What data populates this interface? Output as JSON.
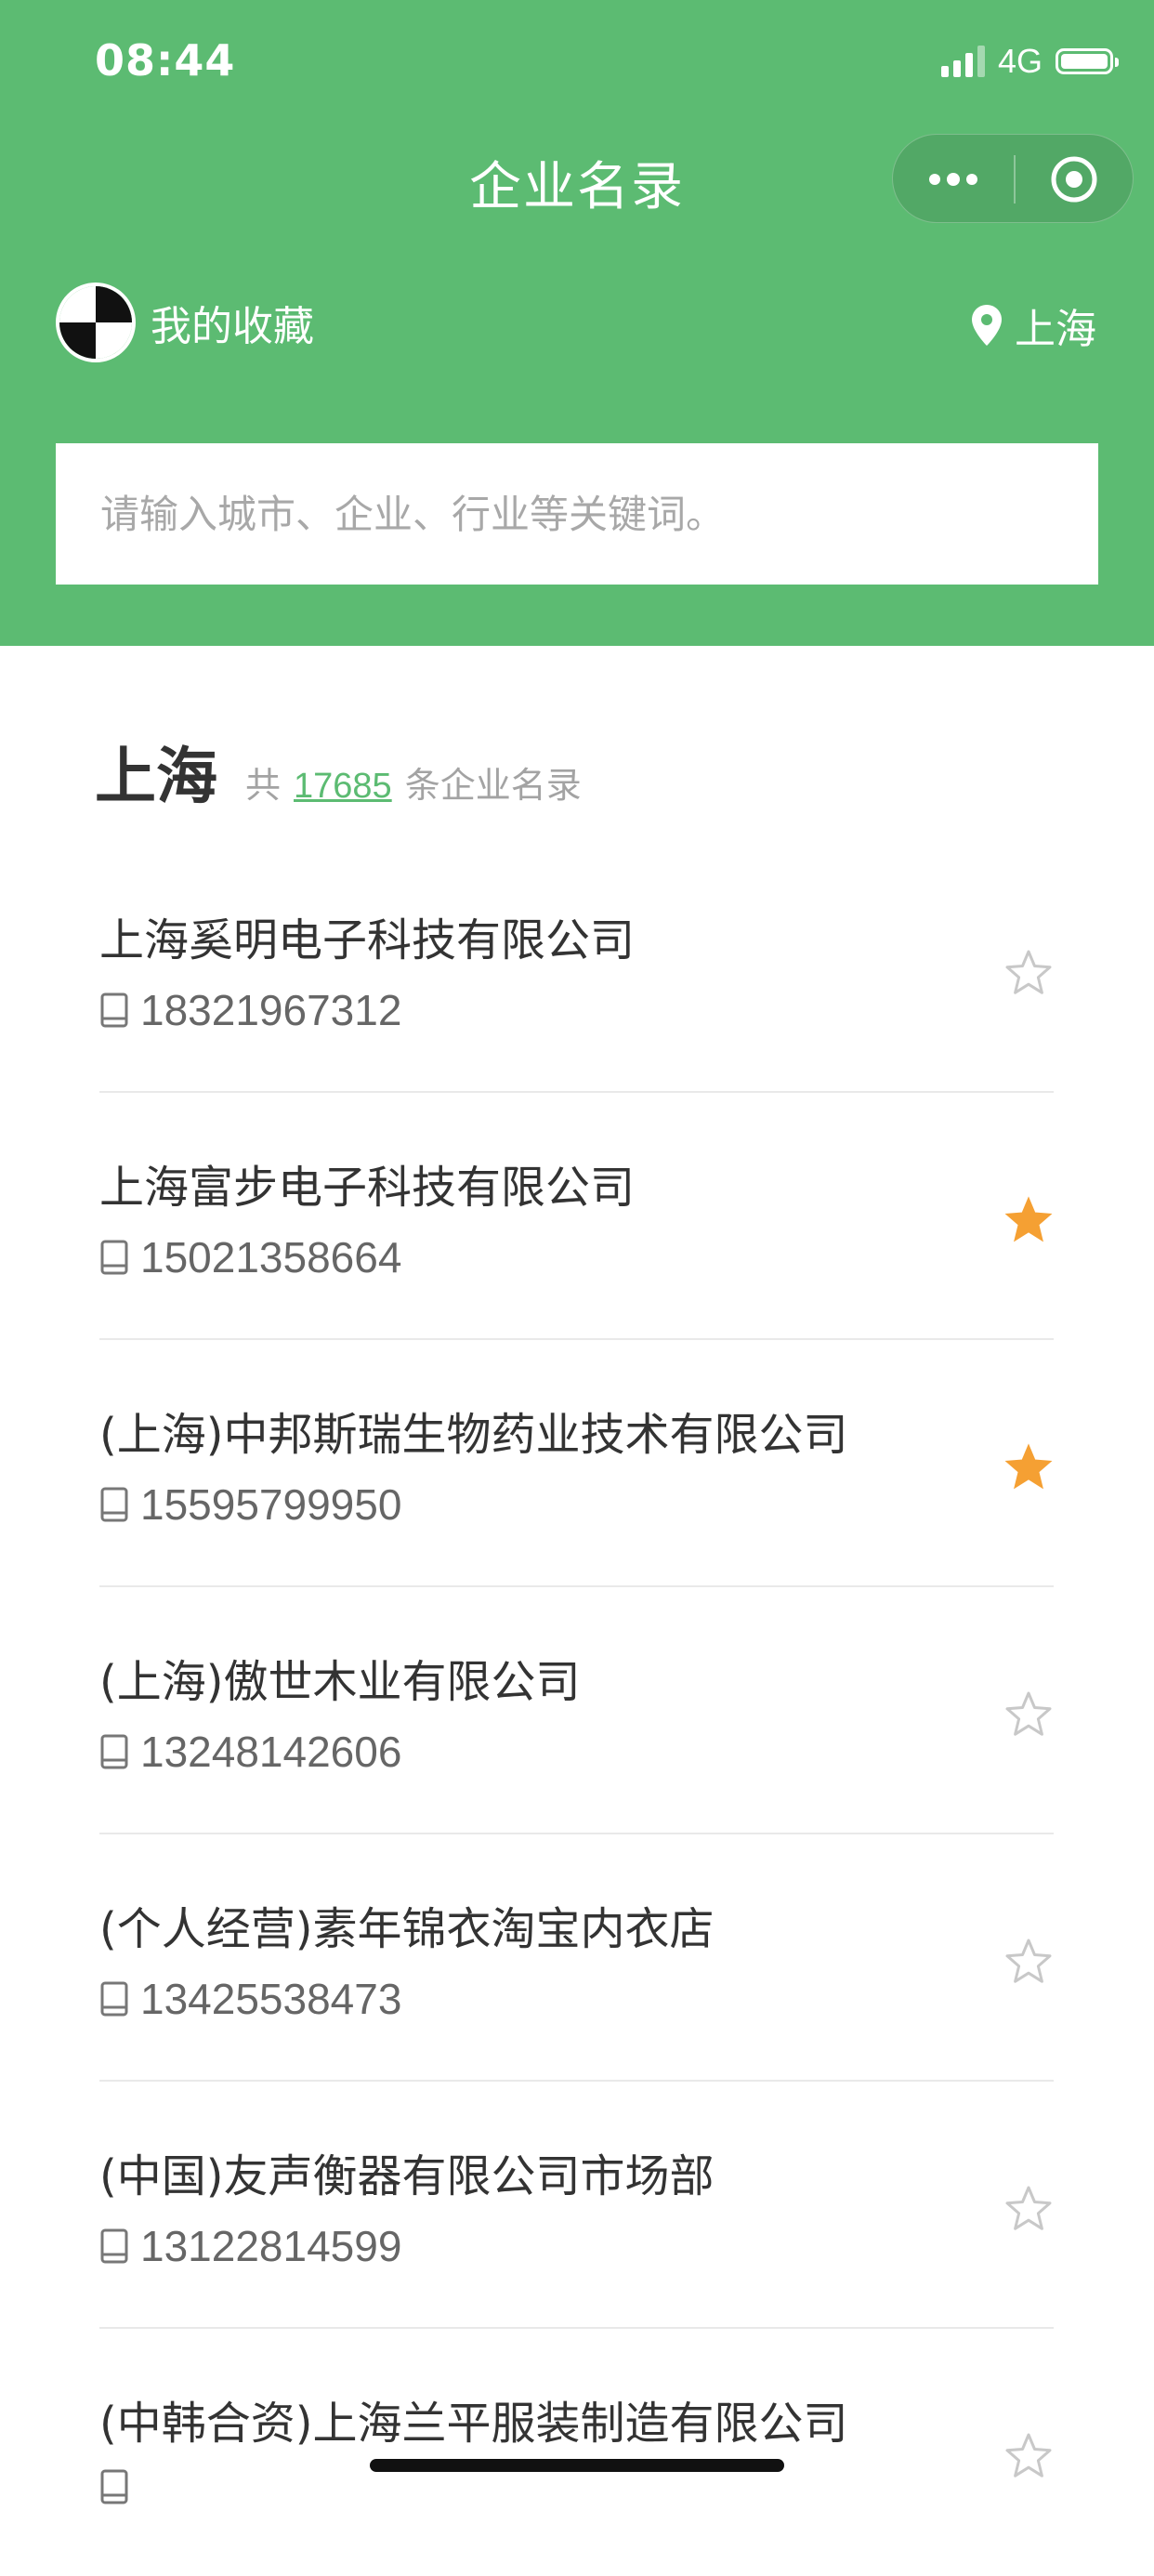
{
  "status_bar": {
    "time": "08:44",
    "network": "4G"
  },
  "header": {
    "title": "企业名录",
    "favorites_label": "我的收藏",
    "location_label": "上海"
  },
  "search": {
    "placeholder": "请输入城市、企业、行业等关键词。",
    "value": ""
  },
  "summary": {
    "city": "上海",
    "prefix": "共",
    "count": "17685",
    "suffix": "条企业名录"
  },
  "companies": [
    {
      "name": "上海奚明电子科技有限公司",
      "phone": "18321967312",
      "favorited": false
    },
    {
      "name": "上海富步电子科技有限公司",
      "phone": "15021358664",
      "favorited": true
    },
    {
      "name": "(上海)中邦斯瑞生物药业技术有限公司",
      "phone": "15595799950",
      "favorited": true
    },
    {
      "name": "(上海)傲世木业有限公司",
      "phone": "13248142606",
      "favorited": false
    },
    {
      "name": "(个人经营)素年锦衣淘宝内衣店",
      "phone": "13425538473",
      "favorited": false
    },
    {
      "name": "(中国)友声衡器有限公司市场部",
      "phone": "13122814599",
      "favorited": false
    },
    {
      "name": "(中韩合资)上海兰平服装制造有限公司",
      "phone": "",
      "favorited": false
    }
  ],
  "colors": {
    "brand_green": "#5cbb72",
    "star_active": "#f5a033",
    "star_inactive": "#c8c8c8"
  }
}
